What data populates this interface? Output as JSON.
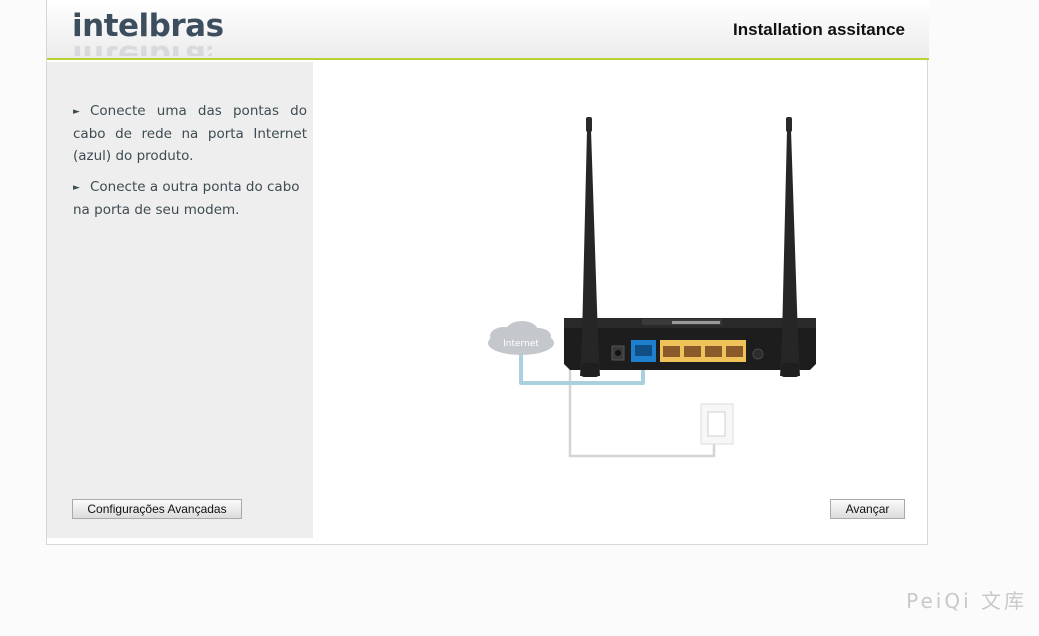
{
  "header": {
    "logo_text": "intelbras",
    "title": "Installation assitance"
  },
  "instructions": [
    {
      "text": "Conecte uma das pontas do cabo de rede na porta Internet (azul) do produto."
    },
    {
      "text": "Conecte a outra ponta do cabo na porta de seu modem."
    }
  ],
  "diagram": {
    "cloud_label": "Internet",
    "colors": {
      "router_body": "#1d1d1d",
      "wan_port": "#1e7fcf",
      "lan_ports": "#f0c35a",
      "cable_blue": "#a8d0df",
      "cable_gray": "#d4d4d4"
    }
  },
  "buttons": {
    "advanced": "Configurações Avançadas",
    "next": "Avançar"
  },
  "watermark": "PeiQi 文库",
  "colors": {
    "accent": "#b5d334",
    "sidebar_bg": "#eeeeee",
    "logo": "#3c4e5e"
  }
}
